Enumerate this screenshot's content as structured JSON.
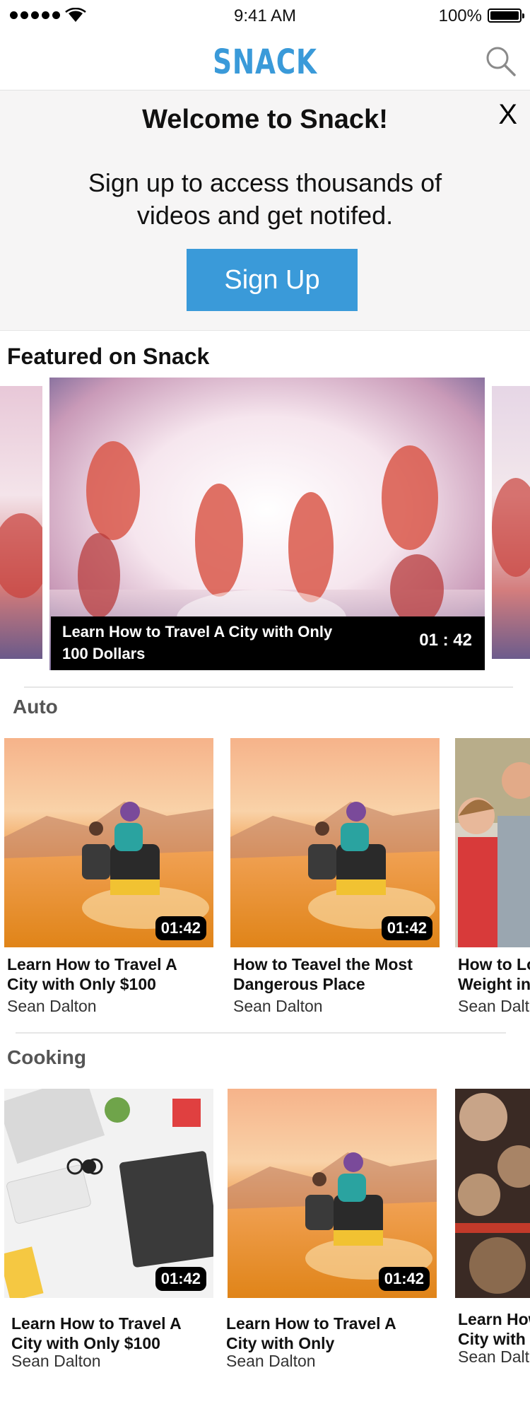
{
  "status_bar": {
    "time": "9:41 AM",
    "battery": "100%"
  },
  "nav": {
    "logo": "SNACK",
    "search_icon": "search-icon"
  },
  "banner": {
    "title": "Welcome to Snack!",
    "close": "X",
    "message": "Sign up to access thousands of videos and get notifed.",
    "button": "Sign Up"
  },
  "featured": {
    "section_title": "Featured on Snack",
    "title": "Learn How to Travel A City with Only 100 Dollars",
    "duration": "01 : 42"
  },
  "categories": [
    {
      "name": "Auto",
      "items": [
        {
          "title_line1": "Learn How to Travel A",
          "title_line2": "City with Only $100",
          "author": "Sean Dalton",
          "duration": "01:42"
        },
        {
          "title_line1": "How to Teavel the Most",
          "title_line2": "Dangerous Place",
          "author": "Sean Dalton",
          "duration": "01:42"
        },
        {
          "title_line1": "How to Lose",
          "title_line2": "Weight in",
          "author": "Sean Dalton",
          "duration": ""
        }
      ]
    },
    {
      "name": "Cooking",
      "items": [
        {
          "title_line1": "Learn How to Travel A",
          "title_line2": "City with Only $100",
          "author": "Sean Dalton",
          "duration": "01:42"
        },
        {
          "title_line1": "Learn How to Travel A",
          "title_line2": "City with Only",
          "author": "Sean Dalton",
          "duration": "01:42"
        },
        {
          "title_line1": "Learn How",
          "title_line2": "City with",
          "author": "Sean Dalton",
          "duration": ""
        }
      ]
    }
  ],
  "colors": {
    "brand": "#3a9ad9",
    "banner_bg": "#f6f5f5"
  }
}
